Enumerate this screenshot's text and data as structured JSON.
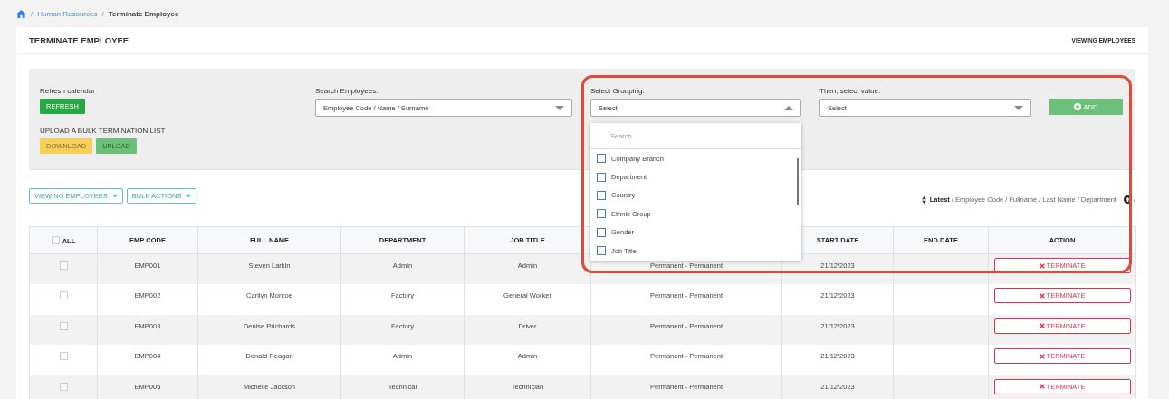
{
  "breadcrumb": [
    {
      "separator": "/",
      "label": "Human Resources",
      "current": false
    },
    {
      "separator": "/",
      "label": "Terminate Employee",
      "current": true
    }
  ],
  "card": {
    "title": "TERMINATE EMPLOYEE",
    "header_link": "VIEWING EMPLOYEES"
  },
  "filters": {
    "refresh_label": "Refresh calendar",
    "refresh_button": "REFRESH",
    "upload_label": "UPLOAD A BULK TERMINATION LIST",
    "download_button": {
      "label": "DOWNLOAD",
      "disabled": false
    },
    "upload_button": {
      "label": "UPLOAD",
      "disabled": true
    },
    "search": {
      "label": "Search Employees:",
      "placeholder": "Employee Code / Name / Surname"
    },
    "grouping": {
      "label": "Select Grouping:",
      "value": "Select",
      "expanded": true,
      "search_placeholder": "Search",
      "options": [
        {
          "label": "Company Branch",
          "checked": false
        },
        {
          "label": "Department",
          "checked": false
        },
        {
          "label": "Country",
          "checked": false
        },
        {
          "label": "Ethnic Group",
          "checked": false
        },
        {
          "label": "Gender",
          "checked": false
        },
        {
          "label": "Job Title",
          "checked": false
        }
      ]
    },
    "value_select": {
      "label": "Then, select value:",
      "value": "Select",
      "expanded": false
    },
    "add_button": "ADD"
  },
  "toolbar": {
    "buttons": [
      "VIEWING EMPLOYEES",
      "BULK ACTIONS"
    ],
    "sort": [
      {
        "label": "Latest",
        "selected": true
      },
      {
        "separator": "/",
        "label": "Employee Code",
        "selected": false
      },
      {
        "separator": "/",
        "label": "Fullname",
        "selected": false
      },
      {
        "separator": "/",
        "label": "Last Name",
        "selected": false
      },
      {
        "separator": "/",
        "label": "Department",
        "selected": false
      }
    ],
    "sort_tail": "/"
  },
  "table": {
    "columns": [
      {
        "kind": "check",
        "label": "ALL"
      },
      {
        "kind": "text",
        "label": "EMP CODE"
      },
      {
        "kind": "text",
        "label": "FULL NAME"
      },
      {
        "kind": "text",
        "label": "DEPARTMENT"
      },
      {
        "kind": "text",
        "label": "JOB TITLE"
      },
      {
        "kind": "blank"
      },
      {
        "kind": "text",
        "label": "START DATE"
      },
      {
        "kind": "text",
        "label": "END DATE"
      },
      {
        "kind": "text",
        "label": "ACTION"
      }
    ],
    "all_checked": false,
    "rows": [
      {
        "selected": false,
        "code": "EMP001",
        "name": "Steven Larkin",
        "department": "Admin",
        "job_title": "Admin",
        "column_6": "Permanent - Permanent",
        "start_date": "21/12/2023",
        "action": "TERMINATE"
      },
      {
        "selected": false,
        "code": "EMP002",
        "name": "Carilyn Monroe",
        "department": "Factory",
        "job_title": "General Worker",
        "column_6": "Permanent - Permanent",
        "start_date": "21/12/2023",
        "action": "TERMINATE"
      },
      {
        "selected": false,
        "code": "EMP003",
        "name": "Denise Prichards",
        "department": "Factory",
        "job_title": "Driver",
        "column_6": "Permanent - Permanent",
        "start_date": "21/12/2023",
        "action": "TERMINATE"
      },
      {
        "selected": false,
        "code": "EMP004",
        "name": "Donald Reagan",
        "department": "Admin",
        "job_title": "Admin",
        "column_6": "Permanent - Permanent",
        "start_date": "21/12/2023",
        "action": "TERMINATE"
      },
      {
        "selected": false,
        "code": "EMP005",
        "name": "Michelle Jackson",
        "department": "Technical",
        "job_title": "Technician",
        "column_6": "Permanent - Permanent",
        "start_date": "21/12/2023",
        "action": "TERMINATE"
      }
    ]
  },
  "highlight": true
}
